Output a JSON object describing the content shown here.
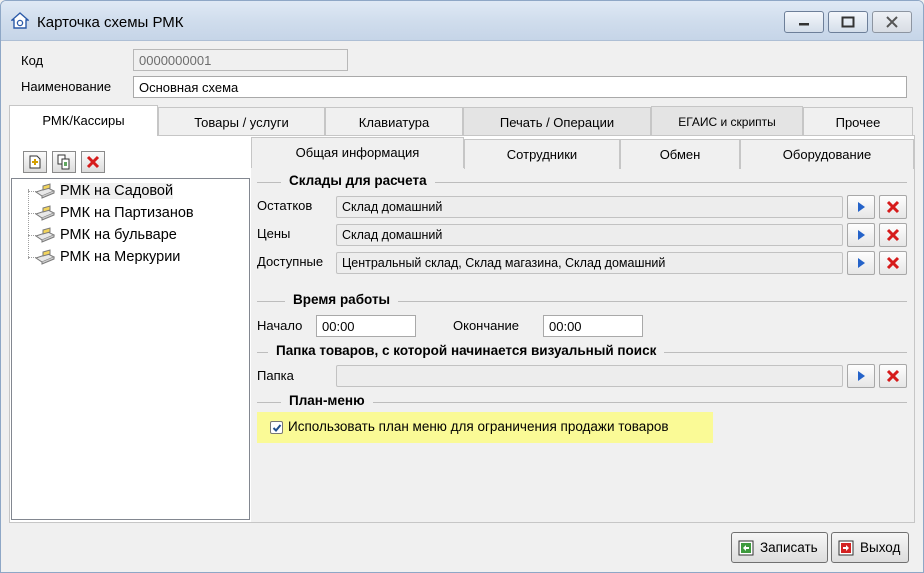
{
  "window": {
    "title": "Карточка схемы РМК",
    "icon": "app-house-icon"
  },
  "header": {
    "code_label": "Код",
    "code_value": "0000000001",
    "name_label": "Наименование",
    "name_value": "Основная схема"
  },
  "tabs": [
    {
      "label": "РМК/Кассиры",
      "active": true
    },
    {
      "label": "Товары / услуги",
      "active": false
    },
    {
      "label": "Клавиатура",
      "active": false
    },
    {
      "label": "Печать / Операции",
      "active": false
    },
    {
      "label": "ЕГАИС и скрипты",
      "active": false
    },
    {
      "label": "Прочее",
      "active": false
    }
  ],
  "tree": {
    "toolbar": [
      "add-icon",
      "copy-icon",
      "delete-icon"
    ],
    "items": [
      {
        "label": "РМК на Садовой",
        "selected": true
      },
      {
        "label": "РМК на Партизанов",
        "selected": false
      },
      {
        "label": "РМК на бульваре",
        "selected": false
      },
      {
        "label": "РМК на Меркурии",
        "selected": false
      }
    ]
  },
  "subtabs": [
    {
      "label": "Общая информация",
      "active": true
    },
    {
      "label": "Сотрудники",
      "active": false
    },
    {
      "label": "Обмен",
      "active": false
    },
    {
      "label": "Оборудование",
      "active": false
    }
  ],
  "warehouses": {
    "title": "Склады для расчета",
    "rows": [
      {
        "label": "Остатков",
        "value": "Склад домашний"
      },
      {
        "label": "Цены",
        "value": "Склад домашний"
      },
      {
        "label": "Доступные",
        "value": "Центральный склад, Склад магазина, Склад домашний"
      }
    ]
  },
  "worktime": {
    "title": "Время работы",
    "start_label": "Начало",
    "start_value": "00:00",
    "end_label": "Окончание",
    "end_value": "00:00"
  },
  "folder": {
    "title": "Папка товаров, с которой начинается визуальный поиск",
    "label": "Папка",
    "value": ""
  },
  "plan_menu": {
    "title": "План-меню",
    "checkbox_label": "Использовать план меню для ограничения продажи товаров",
    "checked": true,
    "highlight_color": "#fafa96"
  },
  "footer": {
    "save_label": "Записать",
    "exit_label": "Выход"
  }
}
